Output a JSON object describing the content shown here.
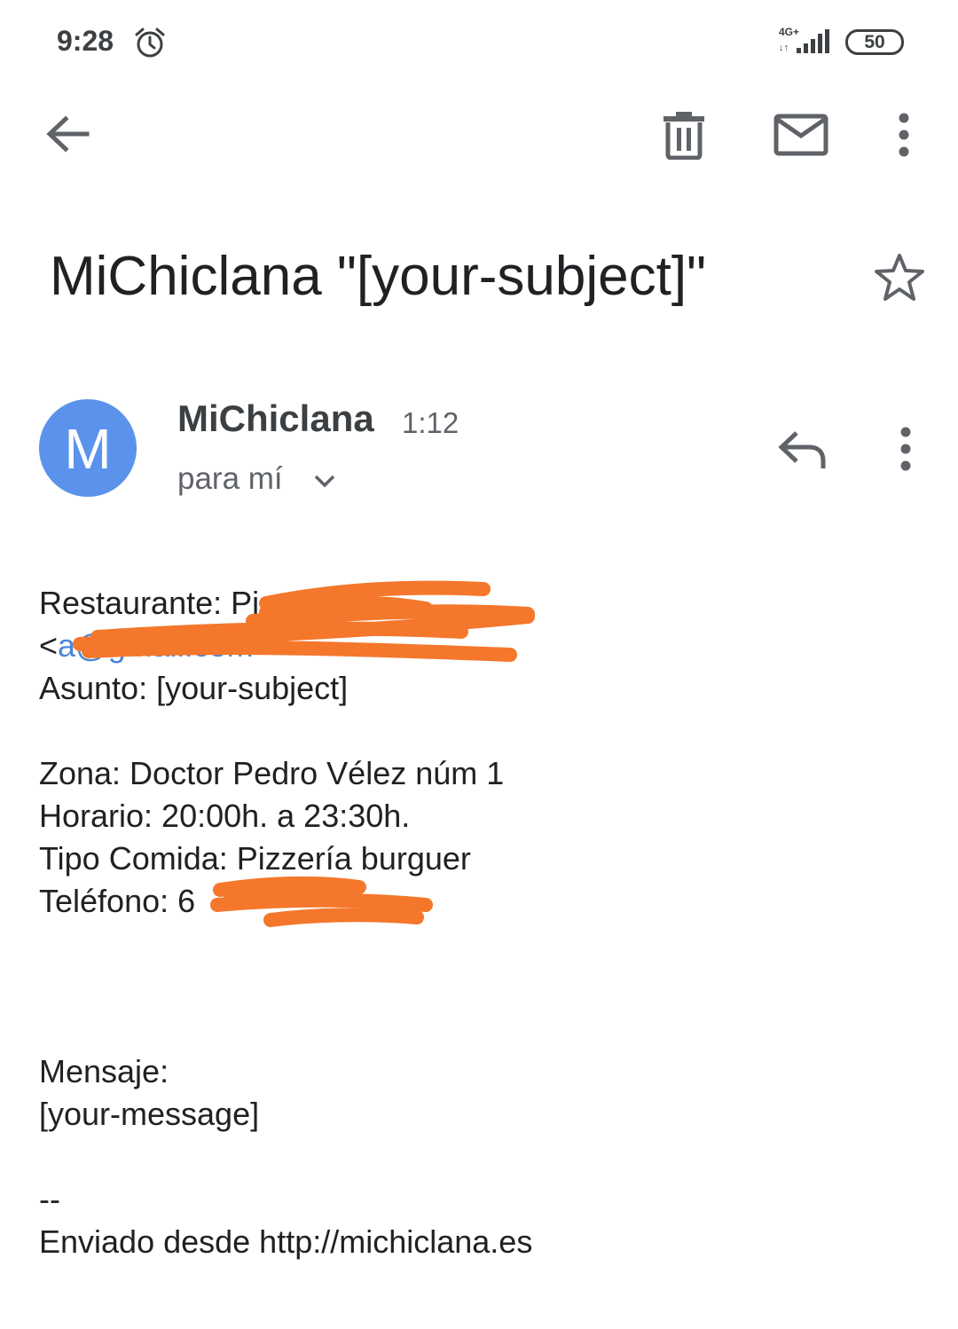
{
  "status_bar": {
    "time": "9:28",
    "network": "4G+",
    "network_arrows": "↓↑",
    "battery": "50",
    "icons": [
      "alarm-clock-icon",
      "signal-bars-icon"
    ]
  },
  "action_bar": {
    "icons": [
      "back-arrow-icon",
      "trash-icon",
      "mail-icon",
      "more-vertical-icon"
    ]
  },
  "email": {
    "subject": "MiChiclana \"[your-subject]\"",
    "starred": false,
    "sender": {
      "initial": "M",
      "name": "MiChiclana",
      "time": "1:12",
      "recipient": "para mí",
      "avatar_color": "#5b93ec"
    },
    "body": {
      "restaurant_label": "Restaurante: Pi",
      "email_open": "<",
      "email_link": "a@gmail.com",
      "email_close": ">",
      "subject_line": "Asunto: [your-subject]",
      "zone": "Zona: Doctor Pedro Vélez núm 1",
      "hours": "Horario: 20:00h. a 23:30h.",
      "food_type": "Tipo Comida: Pizzería burguer",
      "phone": "Teléfono: 6",
      "message_label": "Mensaje:",
      "message": "[your-message]",
      "separator": "--",
      "footer": "Enviado desde http://michiclana.es"
    }
  },
  "colors": {
    "link": "#4a86d8",
    "redaction": "#f4772b",
    "icon": "#5f6368"
  }
}
